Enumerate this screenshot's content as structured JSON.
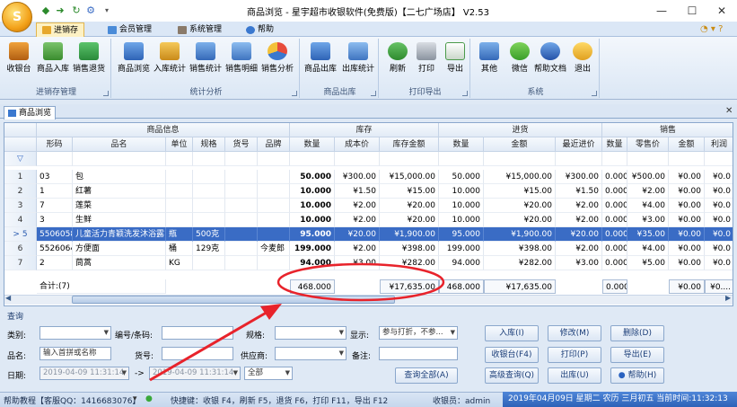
{
  "title_bar": {
    "title": "商品浏览 - 星宇超市收银软件(免费版)【二七广场店】 V2.53",
    "quick_access": [
      "back-arrow-icon",
      "forward-arrow-icon",
      "refresh-icon",
      "settings-icon",
      "dropdown-icon"
    ],
    "window_buttons": {
      "minimize": "—",
      "maximize": "☐",
      "close": "✕"
    }
  },
  "menu_tabs": [
    {
      "label": "进销存",
      "active": true
    },
    {
      "label": "会员管理",
      "active": false
    },
    {
      "label": "系统管理",
      "active": false
    },
    {
      "label": "帮助",
      "active": false
    }
  ],
  "ribbon": {
    "groups": [
      {
        "title": "进销存管理",
        "buttons": [
          "收银台",
          "商品入库",
          "销售退货"
        ]
      },
      {
        "title": "统计分析",
        "buttons": [
          "商品浏览",
          "入库统计",
          "销售统计",
          "销售明细",
          "销售分析"
        ]
      },
      {
        "title": "商品出库",
        "buttons": [
          "商品出库",
          "出库统计"
        ]
      },
      {
        "title": "打印导出",
        "buttons": [
          "刷新",
          "打印",
          "导出"
        ]
      },
      {
        "title": "系统",
        "buttons": [
          "其他",
          "微信",
          "帮助文档",
          "退出"
        ]
      }
    ]
  },
  "document_tab": {
    "label": "商品浏览"
  },
  "grid": {
    "group_headers": [
      "商品信息",
      "库存",
      "进货",
      "销售"
    ],
    "columns": [
      "形码",
      "品名",
      "单位",
      "规格",
      "货号",
      "品牌",
      "数量",
      "成本价",
      "库存金额",
      "数量",
      "金额",
      "最近进价",
      "数量",
      "零售价",
      "金额",
      "利润"
    ],
    "filter_row_marker": "▽",
    "rows": [
      {
        "num": "1",
        "cells": [
          "03",
          "包",
          "",
          "",
          "",
          "",
          "50.000",
          "¥300.00",
          "¥15,000.00",
          "50.000",
          "¥15,000.00",
          "¥300.00",
          "0.000",
          "¥500.00",
          "¥0.00",
          "¥0.0"
        ]
      },
      {
        "num": "2",
        "cells": [
          "1",
          "红薯",
          "",
          "",
          "",
          "",
          "10.000",
          "¥1.50",
          "¥15.00",
          "10.000",
          "¥15.00",
          "¥1.50",
          "0.000",
          "¥2.00",
          "¥0.00",
          "¥0.0"
        ]
      },
      {
        "num": "3",
        "cells": [
          "7",
          "莲菜",
          "",
          "",
          "",
          "",
          "10.000",
          "¥2.00",
          "¥20.00",
          "10.000",
          "¥20.00",
          "¥2.00",
          "0.000",
          "¥4.00",
          "¥0.00",
          "¥0.0"
        ]
      },
      {
        "num": "4",
        "cells": [
          "3",
          "生鲜",
          "",
          "",
          "",
          "",
          "10.000",
          "¥2.00",
          "¥20.00",
          "10.000",
          "¥20.00",
          "¥2.00",
          "0.000",
          "¥3.00",
          "¥0.00",
          "¥0.0"
        ]
      },
      {
        "num": "5",
        "marker": ">",
        "selected": true,
        "cells": [
          "5506058",
          "儿童活力青颖洗发沐浴露",
          "瓶",
          "500克",
          "",
          "",
          "95.000",
          "¥20.00",
          "¥1,900.00",
          "95.000",
          "¥1,900.00",
          "¥20.00",
          "0.000",
          "¥35.00",
          "¥0.00",
          "¥0.0"
        ]
      },
      {
        "num": "6",
        "cells": [
          "5526064",
          "方便面",
          "桶",
          "129克",
          "",
          "今麦郎",
          "199.000",
          "¥2.00",
          "¥398.00",
          "199.000",
          "¥398.00",
          "¥2.00",
          "0.000",
          "¥4.00",
          "¥0.00",
          "¥0.0"
        ]
      },
      {
        "num": "7",
        "cells": [
          "2",
          "茼蒿",
          "KG",
          "",
          "",
          "",
          "94.000",
          "¥3.00",
          "¥282.00",
          "94.000",
          "¥282.00",
          "¥3.00",
          "0.000",
          "¥5.00",
          "¥0.00",
          "¥0.0"
        ]
      }
    ],
    "summary": {
      "label": "合计:(7)",
      "stock_qty": "468.000",
      "stock_amount": "¥17,635.00",
      "purchase_qty": "468.000",
      "purchase_amount": "¥17,635.00",
      "sale_qty": "0.000",
      "sale_amount": "¥0.00",
      "profit": "¥0...."
    }
  },
  "query": {
    "title": "查询",
    "category_label": "类别:",
    "code_label": "编号/条码:",
    "spec_label": "规格:",
    "display_label": "显示:",
    "display_value": "参与打折，不参...",
    "name_label": "品名:",
    "name_placeholder": "输入首拼或名称",
    "itemno_label": "货号:",
    "supplier_label": "供应商:",
    "note_label": "备注:",
    "date_label": "日期:",
    "date_from": "2019-04-09 11:31:14",
    "date_arrow": "->",
    "date_to": "2019-04-09 11:31:14",
    "date_range": "全部",
    "buttons": {
      "inbound": "入库(I)",
      "edit": "修改(M)",
      "delete": "删除(D)",
      "cashier": "收银台(F4)",
      "print": "打印(P)",
      "export": "导出(E)",
      "query_all": "查询全部(A)",
      "advanced": "高级查询(Q)",
      "outbound": "出库(U)",
      "help": "帮助(H)"
    }
  },
  "status_bar": {
    "help": "帮助教程【客服QQ：1416683076】",
    "shortcuts": "快捷键：收银 F4，刷新 F5，退货 F6，打印 F11，导出 F12",
    "cashier": "收银员：admin",
    "datetime": "2019年04月09日 星期二 农历 三月初五 当前时间:11:32:13"
  },
  "colors": {
    "selected_row": "#3a6cc5",
    "annotation": "#e8232b"
  }
}
